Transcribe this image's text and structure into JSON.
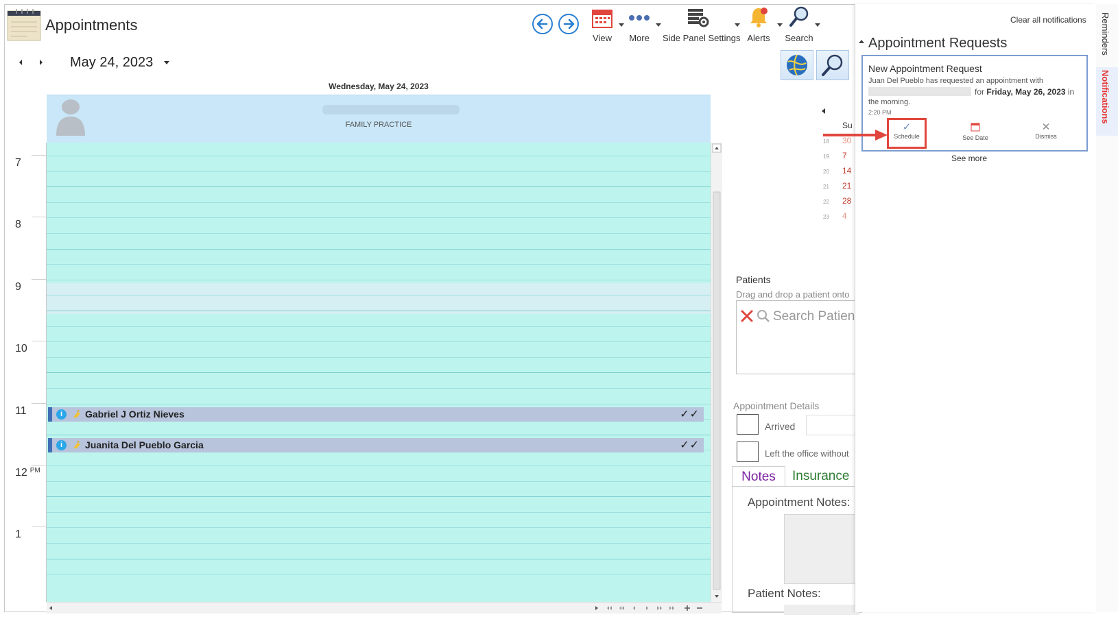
{
  "app": {
    "title": "Appointments"
  },
  "toolbar": {
    "view_label": "View",
    "more_label": "More",
    "side_panel_label": "Side Panel Settings",
    "alerts_label": "Alerts",
    "search_label": "Search"
  },
  "calendar": {
    "date_label": "May 24, 2023",
    "day_header": "Wednesday, May 24, 2023",
    "resource_department": "FAMILY PRACTICE",
    "hours": [
      "7",
      "8",
      "9",
      "10",
      "11",
      "12",
      "1"
    ],
    "ampm_label": "PM",
    "appointments": [
      {
        "name": "Gabriel J Ortiz Nieves",
        "info": "i",
        "checks": "✓✓"
      },
      {
        "name": "Juanita Del Pueblo Garcia",
        "info": "i",
        "checks": "✓✓"
      }
    ]
  },
  "mini_calendar": {
    "header": "Su",
    "rows": [
      {
        "week": "18",
        "day": "30"
      },
      {
        "week": "19",
        "day": "7"
      },
      {
        "week": "20",
        "day": "14"
      },
      {
        "week": "21",
        "day": "21"
      },
      {
        "week": "22",
        "day": "28"
      },
      {
        "week": "23",
        "day": "4"
      }
    ]
  },
  "patients": {
    "title": "Patients",
    "hint": "Drag and drop a patient onto",
    "search_placeholder": "Search Patients"
  },
  "details": {
    "title": "Appointment Details",
    "arrived_label": "Arrived",
    "left_label": "Left the office without"
  },
  "notes_tabs": {
    "notes_label": "Notes",
    "insurance_label": "Insurance",
    "appointment_notes_label": "Appointment Notes:",
    "patient_notes_label": "Patient Notes:"
  },
  "notifications": {
    "clear_all": "Clear all notifications",
    "section_title": "Appointment Requests",
    "card": {
      "title": "New Appointment Request",
      "line1": "Juan  Del Pueblo  has requested an appointment with",
      "line2_prefix": "for",
      "line2_date": "Friday, May 26, 2023",
      "line2_suffix": "in",
      "line3": "the morning.",
      "time": "2:20 PM",
      "schedule_label": "Schedule",
      "see_date_label": "See Date",
      "dismiss_label": "Dismiss"
    },
    "see_more": "See more"
  },
  "side_tabs": {
    "reminders": "Reminders",
    "notifications": "Notifications"
  },
  "colors": {
    "grid_bg": "#bdf5ee",
    "appointment_bg": "#b7c4dc",
    "appointment_accent": "#3f6fb5",
    "resource_header_bg": "#c9e7f8",
    "annotation_red": "#e0463d",
    "notifications_tab_text": "#e53935"
  }
}
